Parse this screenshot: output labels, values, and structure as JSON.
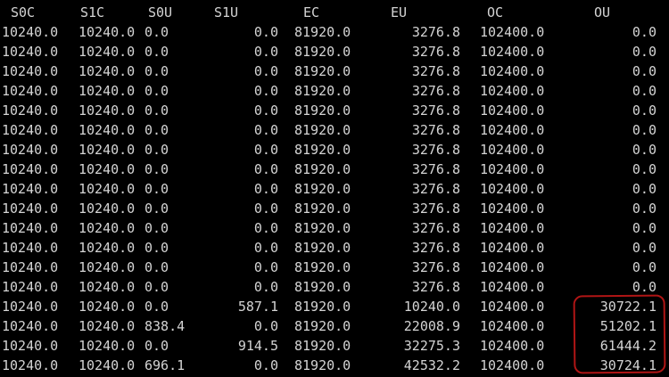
{
  "terminal": {
    "headers": [
      "S0C",
      "S1C",
      "S0U",
      "S1U",
      "EC",
      "EU",
      "OC",
      "OU"
    ],
    "rows": [
      [
        "10240.0",
        "10240.0",
        "0.0",
        "0.0",
        "81920.0",
        "3276.8",
        "102400.0",
        "0.0"
      ],
      [
        "10240.0",
        "10240.0",
        "0.0",
        "0.0",
        "81920.0",
        "3276.8",
        "102400.0",
        "0.0"
      ],
      [
        "10240.0",
        "10240.0",
        "0.0",
        "0.0",
        "81920.0",
        "3276.8",
        "102400.0",
        "0.0"
      ],
      [
        "10240.0",
        "10240.0",
        "0.0",
        "0.0",
        "81920.0",
        "3276.8",
        "102400.0",
        "0.0"
      ],
      [
        "10240.0",
        "10240.0",
        "0.0",
        "0.0",
        "81920.0",
        "3276.8",
        "102400.0",
        "0.0"
      ],
      [
        "10240.0",
        "10240.0",
        "0.0",
        "0.0",
        "81920.0",
        "3276.8",
        "102400.0",
        "0.0"
      ],
      [
        "10240.0",
        "10240.0",
        "0.0",
        "0.0",
        "81920.0",
        "3276.8",
        "102400.0",
        "0.0"
      ],
      [
        "10240.0",
        "10240.0",
        "0.0",
        "0.0",
        "81920.0",
        "3276.8",
        "102400.0",
        "0.0"
      ],
      [
        "10240.0",
        "10240.0",
        "0.0",
        "0.0",
        "81920.0",
        "3276.8",
        "102400.0",
        "0.0"
      ],
      [
        "10240.0",
        "10240.0",
        "0.0",
        "0.0",
        "81920.0",
        "3276.8",
        "102400.0",
        "0.0"
      ],
      [
        "10240.0",
        "10240.0",
        "0.0",
        "0.0",
        "81920.0",
        "3276.8",
        "102400.0",
        "0.0"
      ],
      [
        "10240.0",
        "10240.0",
        "0.0",
        "0.0",
        "81920.0",
        "3276.8",
        "102400.0",
        "0.0"
      ],
      [
        "10240.0",
        "10240.0",
        "0.0",
        "0.0",
        "81920.0",
        "3276.8",
        "102400.0",
        "0.0"
      ],
      [
        "10240.0",
        "10240.0",
        "0.0",
        "0.0",
        "81920.0",
        "3276.8",
        "102400.0",
        "0.0"
      ],
      [
        "10240.0",
        "10240.0",
        "0.0",
        "587.1",
        "81920.0",
        "10240.0",
        "102400.0",
        "30722.1"
      ],
      [
        "10240.0",
        "10240.0",
        "838.4",
        "0.0",
        "81920.0",
        "22008.9",
        "102400.0",
        "51202.1"
      ],
      [
        "10240.0",
        "10240.0",
        "0.0",
        "914.5",
        "81920.0",
        "32275.3",
        "102400.0",
        "61444.2"
      ],
      [
        "10240.0",
        "10240.0",
        "696.1",
        "0.0",
        "81920.0",
        "42532.2",
        "102400.0",
        "30724.1"
      ]
    ],
    "colors": {
      "background": "#000000",
      "text": "#d4d4d4",
      "highlight_border": "#b01515"
    }
  }
}
